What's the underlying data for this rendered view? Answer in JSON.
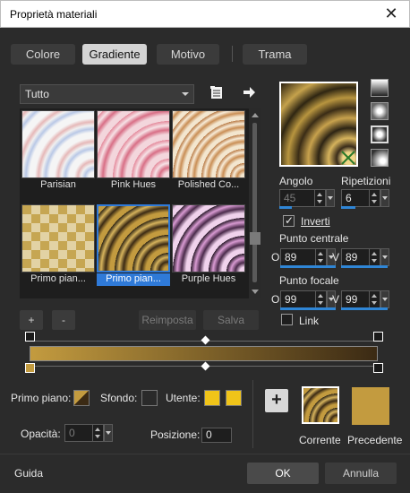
{
  "window": {
    "title": "Proprietà materiali"
  },
  "tabs": [
    {
      "label": "Colore",
      "active": false
    },
    {
      "label": "Gradiente",
      "active": true
    },
    {
      "label": "Motivo",
      "active": false
    },
    {
      "label": "Trama",
      "active": false
    }
  ],
  "category": {
    "value": "Tutto"
  },
  "gallery": {
    "items": [
      {
        "label": "Parisian"
      },
      {
        "label": "Pink Hues"
      },
      {
        "label": "Polished Co..."
      },
      {
        "label": "Primo pian..."
      },
      {
        "label": "Primo pian...",
        "selected": true
      },
      {
        "label": "Purple Hues"
      }
    ]
  },
  "actions": {
    "add": "+",
    "remove": "-",
    "reset": "Reimposta",
    "save": "Salva"
  },
  "angle": {
    "label": "Angolo",
    "value": "45"
  },
  "repeats": {
    "label": "Ripetizioni",
    "value": "6"
  },
  "invert": {
    "label": "Inverti",
    "checked": true
  },
  "center": {
    "label": "Punto centrale",
    "h_label": "O",
    "h_value": "89",
    "v_label": "V",
    "v_value": "89"
  },
  "focal": {
    "label": "Punto focale",
    "h_label": "O",
    "h_value": "99",
    "v_label": "V",
    "v_value": "99"
  },
  "link": {
    "label": "Link",
    "checked": false
  },
  "colors": {
    "foreground_label": "Primo piano:",
    "background_label": "Sfondo:",
    "user_label": "Utente:",
    "opacity_label": "Opacità:",
    "opacity_value": "0",
    "position_label": "Posizione:",
    "position_value": "0",
    "current_label": "Corrente",
    "previous_label": "Precedente",
    "gold": "#c39b3f",
    "dark": "#3b2a14",
    "user_yellow": "#f0c419"
  },
  "footer": {
    "help": "Guida",
    "ok": "OK",
    "cancel": "Annulla"
  }
}
